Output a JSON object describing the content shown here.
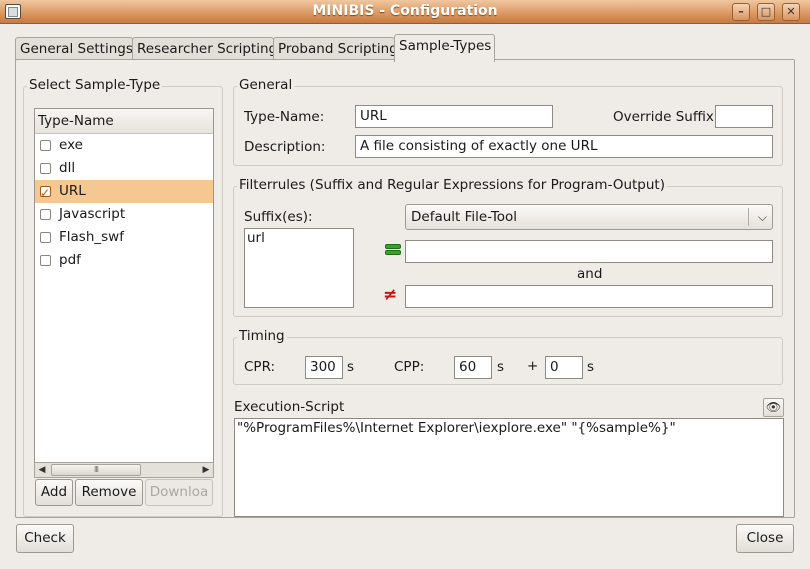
{
  "window": {
    "title": "MINIBIS - Configuration",
    "minimize_glyph": "–",
    "maximize_glyph": "□",
    "close_glyph": "✕"
  },
  "tabs": [
    {
      "label": "General Settings"
    },
    {
      "label": "Researcher Scripting"
    },
    {
      "label": "Proband Scripting"
    },
    {
      "label": "Sample-Types",
      "active": true
    }
  ],
  "sample_types": {
    "frame_label": "Select Sample-Type",
    "column_header": "Type-Name",
    "items": [
      {
        "name": "exe",
        "checked": false
      },
      {
        "name": "dll",
        "checked": false
      },
      {
        "name": "URL",
        "checked": true
      },
      {
        "name": "Javascript",
        "checked": false
      },
      {
        "name": "Flash_swf",
        "checked": false
      },
      {
        "name": "pdf",
        "checked": false
      }
    ],
    "scroll_left": "◀",
    "scroll_right": "▶",
    "scroll_thumb_grip": "III",
    "add_label": "Add",
    "remove_label": "Remove",
    "download_label": "Downloa"
  },
  "general": {
    "frame_label": "General",
    "type_name_label": "Type-Name:",
    "type_name_value": "URL",
    "override_suffix_label": "Override Suffix:",
    "override_suffix_value": "",
    "description_label": "Description:",
    "description_value": "A file consisting of exactly one URL"
  },
  "filterrules": {
    "frame_label": "Filterrules (Suffix and Regular Expressions for Program-Output)",
    "suffixes_label": "Suffix(es):",
    "suffixes_value": "url",
    "tool_selected": "Default File-Tool",
    "match_regex": "",
    "and_label": "and",
    "not_match_regex": "",
    "equal_icon": "equal-icon",
    "not_equal_icon": "not-equal-icon",
    "not_equal_glyph": "≠",
    "dropdown_glyph": "⌵"
  },
  "timing": {
    "frame_label": "Timing",
    "cpr_label": "CPR:",
    "cpr_value": "300",
    "cpr_unit": "s",
    "cpp_label": "CPP:",
    "cpp_value": "60",
    "cpp_unit": "s",
    "plus_label": "+",
    "extra_value": "0",
    "extra_unit": "s"
  },
  "execution": {
    "label": "Execution-Script",
    "script": "\"%ProgramFiles%\\Internet Explorer\\iexplore.exe\" \"{%sample%}\"",
    "eye_glyph": "👁"
  },
  "footer": {
    "check_label": "Check",
    "close_label": "Close"
  }
}
